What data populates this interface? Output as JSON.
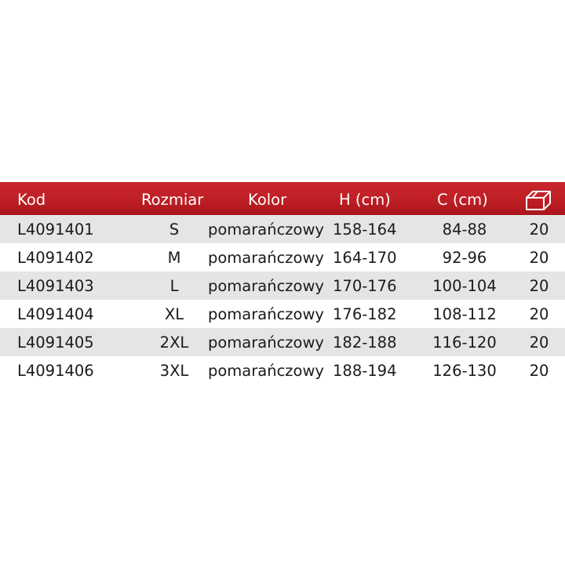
{
  "table": {
    "headers": {
      "kod": "Kod",
      "rozmiar": "Rozmiar",
      "kolor": "Kolor",
      "h": "H (cm)",
      "c": "C (cm)",
      "package_icon": "box-icon"
    },
    "header_color": "#c0232a",
    "stripe_color": "#e5e5e5",
    "rows": [
      {
        "kod": "L4091401",
        "rozmiar": "S",
        "kolor": "pomarańczowy",
        "h": "158-164",
        "c": "84-88",
        "qty": "20"
      },
      {
        "kod": "L4091402",
        "rozmiar": "M",
        "kolor": "pomarańczowy",
        "h": "164-170",
        "c": "92-96",
        "qty": "20"
      },
      {
        "kod": "L4091403",
        "rozmiar": "L",
        "kolor": "pomarańczowy",
        "h": "170-176",
        "c": "100-104",
        "qty": "20"
      },
      {
        "kod": "L4091404",
        "rozmiar": "XL",
        "kolor": "pomarańczowy",
        "h": "176-182",
        "c": "108-112",
        "qty": "20"
      },
      {
        "kod": "L4091405",
        "rozmiar": "2XL",
        "kolor": "pomarańczowy",
        "h": "182-188",
        "c": "116-120",
        "qty": "20"
      },
      {
        "kod": "L4091406",
        "rozmiar": "3XL",
        "kolor": "pomarańczowy",
        "h": "188-194",
        "c": "126-130",
        "qty": "20"
      }
    ]
  }
}
